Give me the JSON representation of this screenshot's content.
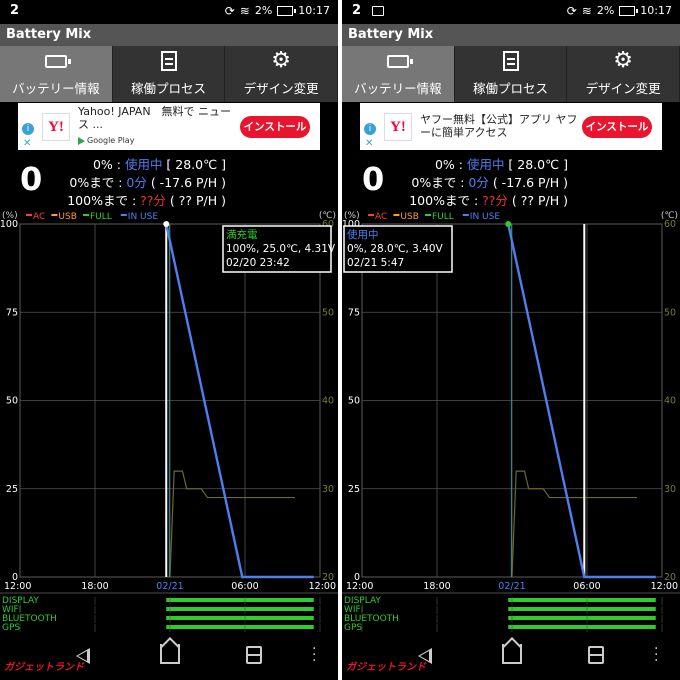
{
  "statusbar": {
    "left_num": "2",
    "battery_pct": "2%",
    "time": "10:17"
  },
  "app": {
    "title": "Battery Mix"
  },
  "tabs": [
    {
      "label": "バッテリー情報",
      "icon": "battery-icon",
      "active": true
    },
    {
      "label": "稼働プロセス",
      "icon": "list-icon",
      "active": false
    },
    {
      "label": "デザイン変更",
      "icon": "gear-icon",
      "active": false
    }
  ],
  "ads": [
    {
      "brand": "Y!",
      "text": "Yahoo! JAPAN　無料で ニュース ...",
      "sub": "Google Play",
      "button": "インストール"
    },
    {
      "brand": "Y!",
      "text": "ヤフー無料【公式】アプリ ヤフーに簡単アクセス",
      "sub": "",
      "button": "インストール"
    }
  ],
  "info": {
    "level": "0",
    "line1_prefix": "0% : ",
    "line1_status": "使用中",
    "line1_temp": " [ 28.0℃ ]",
    "line2_prefix": "0%まで : ",
    "line2_value": "0分",
    "line2_rate": " ( -17.6 P/H )",
    "line3_prefix": "100%まで : ",
    "line3_value": "??分",
    "line3_rate": " ( ?? P/H )"
  },
  "chart_common": {
    "unit_left": "(%)",
    "unit_right": "(℃)",
    "legend": [
      {
        "label": "AC",
        "color": "#ff3b3b"
      },
      {
        "label": "USB",
        "color": "#ff9a2e"
      },
      {
        "label": "FULL",
        "color": "#2ecc2e"
      },
      {
        "label": "IN USE",
        "color": "#4f7ef0"
      }
    ],
    "x_ticks": [
      "12:00",
      "18:00",
      "02/21",
      "06:00",
      "12:00"
    ],
    "usage_rows": [
      "DISPLAY",
      "WIFI",
      "BLUETOOTH",
      "GPS"
    ]
  },
  "chart_data": [
    {
      "type": "line",
      "title": "",
      "xlabel": "",
      "ylabel": "(%)",
      "y2label": "(℃)",
      "ylim": [
        0,
        100
      ],
      "y2lim": [
        20,
        60
      ],
      "y_ticks": [
        0,
        25,
        50,
        75,
        100
      ],
      "y2_ticks": [
        20,
        30,
        40,
        50,
        60
      ],
      "x_range_hours": [
        "02/20 12:00",
        "02/21 12:00"
      ],
      "series": [
        {
          "name": "IN USE",
          "color": "#4f7ef0",
          "points": [
            [
              "02/20 23:42",
              100
            ],
            [
              "02/21 05:47",
              0
            ],
            [
              "02/21 11:30",
              0
            ]
          ]
        }
      ],
      "temperature": {
        "color": "#6a6a2a",
        "points": [
          [
            "02/21 00:00",
            20
          ],
          [
            "02/21 00:20",
            32
          ],
          [
            "02/21 01:00",
            32
          ],
          [
            "02/21 01:20",
            30
          ],
          [
            "02/21 02:30",
            30
          ],
          [
            "02/21 03:00",
            29
          ],
          [
            "02/21 10:00",
            29
          ]
        ]
      },
      "cursor": {
        "time": "02/20 23:42",
        "dot_color": "#ffffff"
      },
      "tooltip": {
        "status": "満充電",
        "status_color": "#2ecc2e",
        "detail": "100%, 25.0℃, 4.31V",
        "time": "02/20 23:42"
      },
      "usage_bars": {
        "DISPLAY": [
          [
            "02/20 23:42",
            "02/21 11:30"
          ]
        ],
        "WIFI": [
          [
            "02/20 23:42",
            "02/21 11:30"
          ]
        ],
        "BLUETOOTH": [
          [
            "02/20 23:42",
            "02/21 11:30"
          ]
        ],
        "GPS": [
          [
            "02/20 23:42",
            "02/21 11:30"
          ]
        ]
      }
    },
    {
      "type": "line",
      "title": "",
      "xlabel": "",
      "ylabel": "(%)",
      "y2label": "(℃)",
      "ylim": [
        0,
        100
      ],
      "y2lim": [
        20,
        60
      ],
      "y_ticks": [
        0,
        25,
        50,
        75,
        100
      ],
      "y2_ticks": [
        20,
        30,
        40,
        50,
        60
      ],
      "x_range_hours": [
        "02/20 12:00",
        "02/21 12:00"
      ],
      "series": [
        {
          "name": "IN USE",
          "color": "#4f7ef0",
          "points": [
            [
              "02/20 23:42",
              100
            ],
            [
              "02/21 05:47",
              0
            ],
            [
              "02/21 11:30",
              0
            ]
          ]
        }
      ],
      "temperature": {
        "color": "#6a6a2a",
        "points": [
          [
            "02/21 00:00",
            20
          ],
          [
            "02/21 00:20",
            32
          ],
          [
            "02/21 01:00",
            32
          ],
          [
            "02/21 01:20",
            30
          ],
          [
            "02/21 02:30",
            30
          ],
          [
            "02/21 03:00",
            29
          ],
          [
            "02/21 10:00",
            29
          ]
        ]
      },
      "cursor": {
        "time": "02/21 05:47",
        "dot_color": "#2ecc2e"
      },
      "tooltip": {
        "status": "使用中",
        "status_color": "#4f7ef0",
        "detail": "0%, 28.0℃, 3.40V",
        "time": "02/21 5:47"
      },
      "usage_bars": {
        "DISPLAY": [
          [
            "02/20 23:42",
            "02/21 11:30"
          ]
        ],
        "WIFI": [
          [
            "02/20 23:42",
            "02/21 11:30"
          ]
        ],
        "BLUETOOTH": [
          [
            "02/20 23:42",
            "02/21 11:30"
          ]
        ],
        "GPS": [
          [
            "02/20 23:42",
            "02/21 11:30"
          ]
        ]
      }
    }
  ],
  "watermark": "ガジェットランド"
}
